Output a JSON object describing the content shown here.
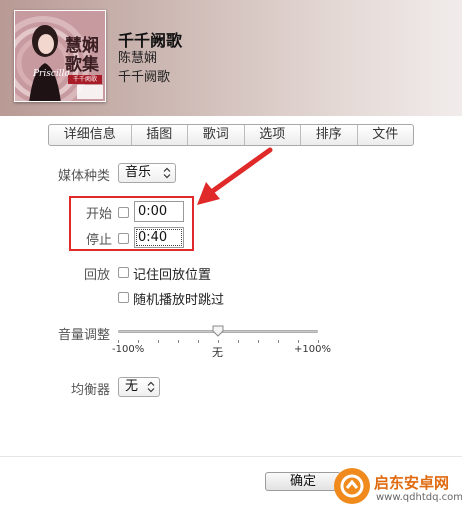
{
  "song": {
    "title": "千千阙歌",
    "artist": "陈慧娴",
    "album": "千千阙歌"
  },
  "artwork": {
    "title": "慧娴歌集",
    "script": "Priscilla",
    "label": "千千阙歌"
  },
  "tabs": [
    "详细信息",
    "插图",
    "歌词",
    "选项",
    "排序",
    "文件"
  ],
  "options": {
    "media_kind_label": "媒体种类",
    "media_kind_value": "音乐",
    "start_label": "开始",
    "start_value": "0:00",
    "stop_label": "停止",
    "stop_value": "0:40",
    "playback_label": "回放",
    "remember_position": "记住回放位置",
    "skip_shuffle": "随机播放时跳过",
    "volume_label": "音量调整",
    "volume_min": "-100%",
    "volume_mid": "无",
    "volume_max": "+100%",
    "volume_level": 0.5,
    "eq_label": "均衡器",
    "eq_value": "无"
  },
  "footer": {
    "ok_label": "确定"
  },
  "watermark": {
    "name": "启东安卓网",
    "url": "www.qdhtdq.com"
  },
  "colors": {
    "annotation": "#e02a2a",
    "watermark": "#f08a1c"
  }
}
